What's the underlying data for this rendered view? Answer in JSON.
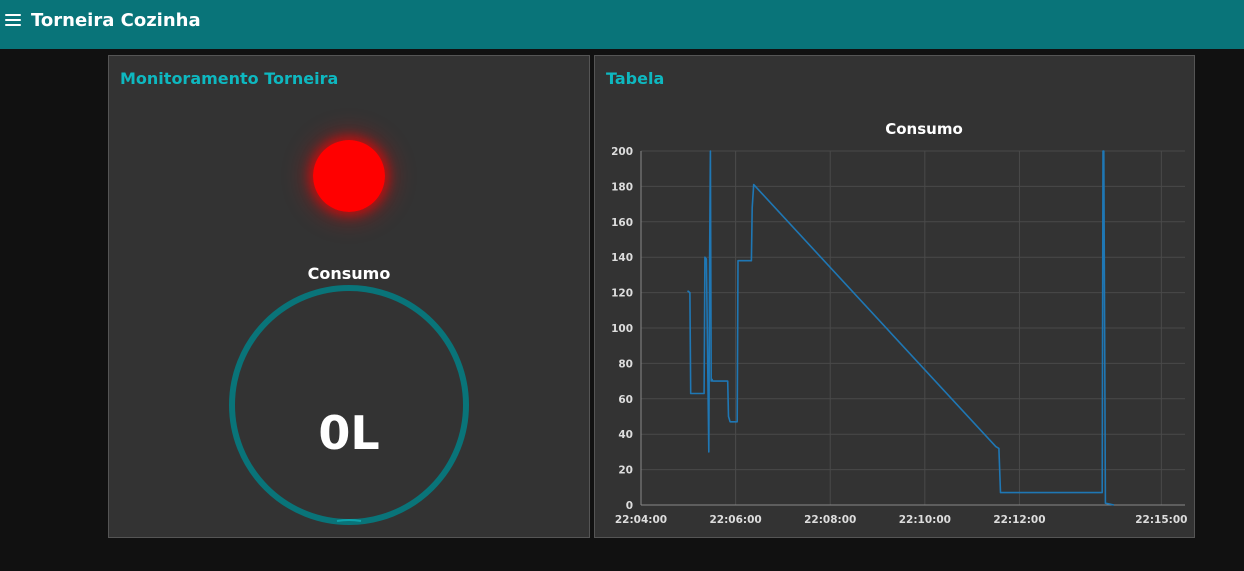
{
  "app": {
    "title": "Torneira Cozinha",
    "menu_icon": "menu-icon",
    "toolbar_color": "#097479"
  },
  "monitor": {
    "title": "Monitoramento Torneira",
    "led_state": "on",
    "led_color": "#ff0000",
    "gauge": {
      "label": "Consumo",
      "value_text": "0L",
      "value": 0,
      "color": "#097479"
    }
  },
  "table_card": {
    "title": "Tabela",
    "chart_data": {
      "type": "line",
      "title": "Consumo",
      "xlabel": "",
      "ylabel": "",
      "x_ticks": [
        "22:04:00",
        "22:06:00",
        "22:08:00",
        "22:10:00",
        "22:12:00",
        "22:15:00"
      ],
      "y_ticks": [
        "0",
        "20",
        "40",
        "60",
        "80",
        "100",
        "120",
        "140",
        "160",
        "180",
        "200"
      ],
      "ylim": [
        0,
        200
      ],
      "xlim": [
        "22:04:00",
        "22:15:30"
      ],
      "grid": true,
      "line_color": "#1f77b4",
      "series": [
        {
          "x": [
            "22:04:59",
            "22:05:02",
            "22:05:03",
            "22:05:05",
            "22:05:20",
            "22:05:21",
            "22:05:23",
            "22:05:26",
            "22:05:27",
            "22:05:28",
            "22:05:29",
            "22:05:30",
            "22:05:31",
            "22:05:33",
            "22:05:50",
            "22:05:51",
            "22:05:53",
            "22:06:02",
            "22:06:03",
            "22:06:05",
            "22:06:20",
            "22:06:21",
            "22:06:23",
            "22:11:30",
            "22:11:34",
            "22:11:36",
            "22:13:45",
            "22:13:46",
            "22:13:47",
            "22:13:49",
            "22:14:00"
          ],
          "y": [
            121,
            120,
            63,
            63,
            63,
            140,
            139,
            30,
            138,
            200,
            70,
            71,
            70,
            70,
            70,
            50,
            47,
            47,
            138,
            138,
            138,
            168,
            181,
            33,
            32,
            7,
            7,
            200,
            200,
            1,
            0
          ]
        }
      ]
    }
  }
}
